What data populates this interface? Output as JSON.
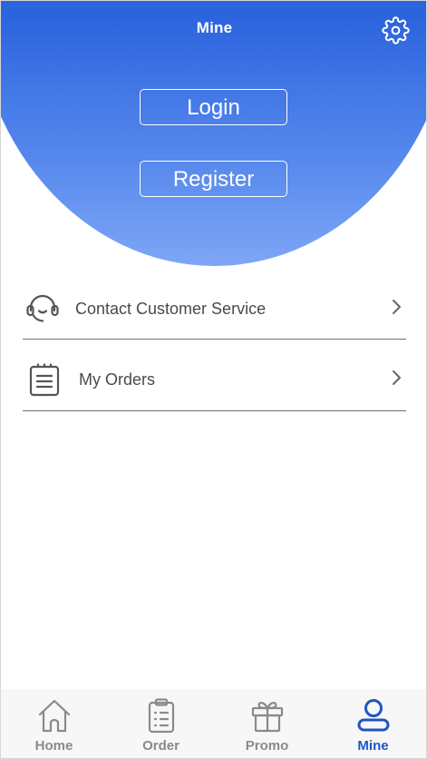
{
  "header": {
    "title": "Mine",
    "settings_icon": "gear-icon",
    "login_label": "Login",
    "register_label": "Register",
    "gradient_top": "#1f5bd6",
    "gradient_bottom": "#7ea6f6"
  },
  "menu": {
    "items": [
      {
        "label": "Contact Customer Service",
        "icon": "headset-icon"
      },
      {
        "label": "My Orders",
        "icon": "clipboard-list-icon"
      }
    ]
  },
  "tabbar": {
    "active_color": "#1f55c5",
    "inactive_color": "#8a8a8a",
    "tabs": [
      {
        "label": "Home",
        "icon": "home-icon",
        "active": false
      },
      {
        "label": "Order",
        "icon": "clipboard-icon",
        "active": false
      },
      {
        "label": "Promo",
        "icon": "gift-icon",
        "active": false
      },
      {
        "label": "Mine",
        "icon": "user-icon",
        "active": true
      }
    ]
  }
}
